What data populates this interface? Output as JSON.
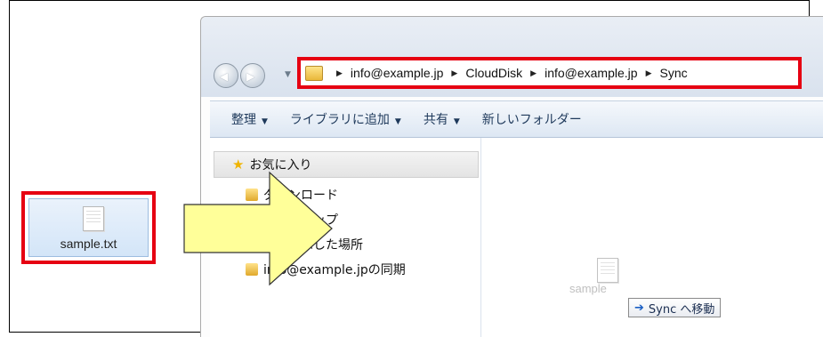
{
  "desktop": {
    "file_name": "sample.txt"
  },
  "address_bar": {
    "crumbs": [
      "info@example.jp",
      "CloudDisk",
      "info@example.jp",
      "Sync"
    ]
  },
  "toolbar": {
    "items": [
      "整理",
      "ライブラリに追加",
      "共有",
      "新しいフォルダー"
    ]
  },
  "sidebar": {
    "favorites": "お気に入り",
    "items": [
      "ダウンロード",
      "デスクトップ",
      "最近表示した場所",
      "info@example.jpの同期"
    ]
  },
  "content": {
    "drag_label": "sample",
    "drop_hint": "Sync へ移動"
  },
  "colors": {
    "highlight": "#e60012",
    "arrow_fill": "#ffff99"
  }
}
